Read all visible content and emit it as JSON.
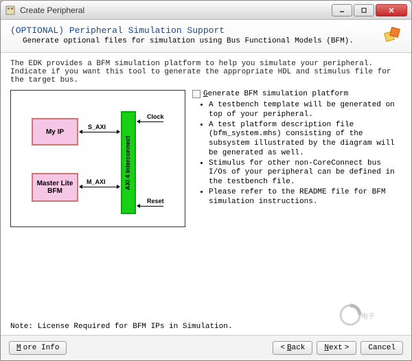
{
  "window": {
    "title": "Create Peripheral"
  },
  "header": {
    "title": "(OPTIONAL) Peripheral Simulation Support",
    "subtitle": "Generate optional files for simulation using Bus Functional Models (BFM)."
  },
  "body": {
    "intro": "The EDK provides a BFM simulation platform to help you simulate your peripheral. Indicate if you want this tool to generate the appropriate HDL and stimulus file for the target bus.",
    "checkbox_label": "Generate BFM simulation platform",
    "bullets": [
      "A testbench template will be generated on top of your peripheral.",
      "A test platform description file (bfm_system.mhs) consisting of the subsystem illustrated by the diagram will be generated as well.",
      "Stimulus for other non-CoreConnect bus I/Os of your peripheral can be defined in the testbench file.",
      "Please refer to the README file for BFM simulation instructions."
    ],
    "note": "Note: License Required for BFM IPs in Simulation."
  },
  "diagram": {
    "my_ip": "My IP",
    "bfm": "Master Lite BFM",
    "interconnect": "AXI 4 Interconnect",
    "s_axi": "S_AXI",
    "m_axi": "M_AXI",
    "clock": "Clock",
    "reset": "Reset"
  },
  "footer": {
    "more_info": "More Info",
    "back": "Back",
    "next": "Next",
    "cancel": "Cancel"
  }
}
